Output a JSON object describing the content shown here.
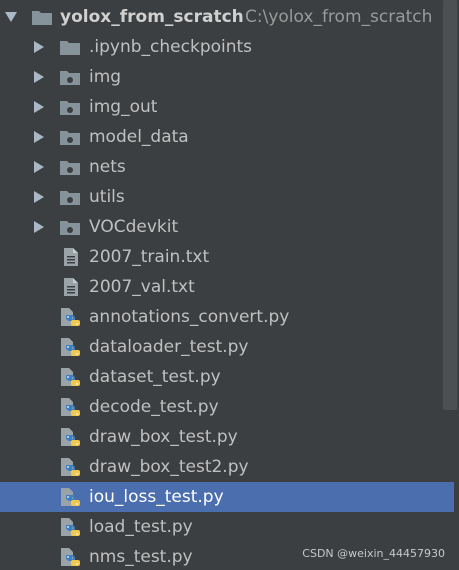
{
  "project": {
    "name": "yolox_from_scratch",
    "path": "C:\\yolox_from_scratch"
  },
  "folders": [
    {
      "label": ".ipynb_checkpoints",
      "icon": "folder-icon"
    },
    {
      "label": "img",
      "icon": "folder-icon"
    },
    {
      "label": "img_out",
      "icon": "folder-icon"
    },
    {
      "label": "model_data",
      "icon": "folder-icon"
    },
    {
      "label": "nets",
      "icon": "folder-icon"
    },
    {
      "label": "utils",
      "icon": "folder-icon"
    },
    {
      "label": "VOCdevkit",
      "icon": "folder-icon"
    }
  ],
  "files": [
    {
      "label": "2007_train.txt",
      "icon": "text-file-icon"
    },
    {
      "label": "2007_val.txt",
      "icon": "text-file-icon"
    },
    {
      "label": "annotations_convert.py",
      "icon": "python-file-icon"
    },
    {
      "label": "dataloader_test.py",
      "icon": "python-file-icon"
    },
    {
      "label": "dataset_test.py",
      "icon": "python-file-icon"
    },
    {
      "label": "decode_test.py",
      "icon": "python-file-icon"
    },
    {
      "label": "draw_box_test.py",
      "icon": "python-file-icon"
    },
    {
      "label": "draw_box_test2.py",
      "icon": "python-file-icon"
    },
    {
      "label": "iou_loss_test.py",
      "icon": "python-file-icon"
    },
    {
      "label": "load_test.py",
      "icon": "python-file-icon"
    },
    {
      "label": "nms_test.py",
      "icon": "python-file-icon"
    }
  ],
  "selected_file": "iou_loss_test.py",
  "watermark": "CSDN @weixin_44457930",
  "colors": {
    "background": "#3c3f41",
    "selection": "#4b6eaf",
    "text": "#c0c0c0",
    "folder": "#87939a",
    "python_blue": "#3e7fc1",
    "python_yellow": "#f2c94c"
  }
}
